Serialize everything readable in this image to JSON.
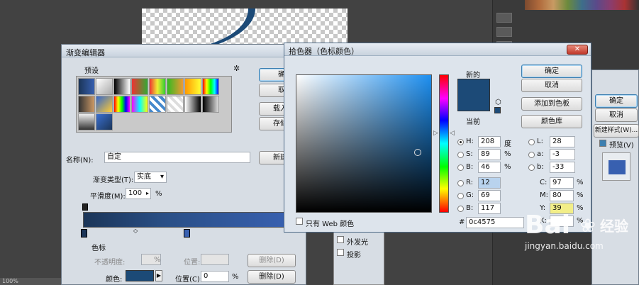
{
  "colors": {
    "workspace_bg": "#424242",
    "current_color": "#1c4a77",
    "dialog_bg": "#d7dde4",
    "gradient_start": "#1b3558",
    "gradient_end": "#3860b0"
  },
  "status": {
    "zoom": "100%"
  },
  "gradient_editor": {
    "title": "渐变编辑器",
    "presets_label": "预设",
    "settings_icon": "gear-icon",
    "buttons": {
      "ok": "确",
      "cancel": "取",
      "load": "载入(",
      "save": "存储(",
      "new": "新建("
    },
    "name_label": "名称(N):",
    "name_value": "自定",
    "gradient_type_label": "渐变类型(T):",
    "gradient_type_value": "实底",
    "smoothness_label": "平滑度(M):",
    "smoothness_value": "100",
    "smoothness_unit": "%",
    "stops_group_label": "色标",
    "opacity_label": "不透明度:",
    "opacity_unit": "%",
    "opacity_location_label": "位置:",
    "opacity_delete": "删除(D)",
    "color_label": "颜色:",
    "color_location_label": "位置(C):",
    "color_location_value": "0",
    "color_location_unit": "%",
    "color_delete": "删除(D)"
  },
  "color_picker": {
    "title": "拾色器（色标颜色）",
    "new_label": "新的",
    "current_label": "当前",
    "buttons": {
      "ok": "确定",
      "cancel": "取消",
      "add_to_swatches": "添加到色板",
      "color_libraries": "颜色库"
    },
    "hsb": [
      {
        "label": "H:",
        "value": "208",
        "unit": "度",
        "selected": true
      },
      {
        "label": "S:",
        "value": "89",
        "unit": "%"
      },
      {
        "label": "B:",
        "value": "46",
        "unit": "%"
      }
    ],
    "rgb": [
      {
        "label": "R:",
        "value": "12"
      },
      {
        "label": "G:",
        "value": "69"
      },
      {
        "label": "B:",
        "value": "117"
      }
    ],
    "lab": [
      {
        "label": "L:",
        "value": "28"
      },
      {
        "label": "a:",
        "value": "-3"
      },
      {
        "label": "b:",
        "value": "-33"
      }
    ],
    "cmyk": [
      {
        "label": "C:",
        "value": "97",
        "unit": "%"
      },
      {
        "label": "M:",
        "value": "80",
        "unit": "%"
      },
      {
        "label": "Y:",
        "value": "39",
        "unit": "%"
      },
      {
        "label": "K:",
        "value": "",
        "unit": "%"
      }
    ],
    "hex_label": "#",
    "hex_value": "0c4575",
    "web_only_label": "只有 Web 颜色"
  },
  "layer_style": {
    "buttons": {
      "ok": "确定",
      "cancel": "取消",
      "new_style": "新建样式(W)..."
    },
    "preview_label": "预览(V)",
    "list_items": [
      "外发光",
      "投影"
    ]
  },
  "watermark": {
    "brand": "Bai",
    "brand_cn": "经验",
    "url": "jingyan.baidu.com"
  }
}
